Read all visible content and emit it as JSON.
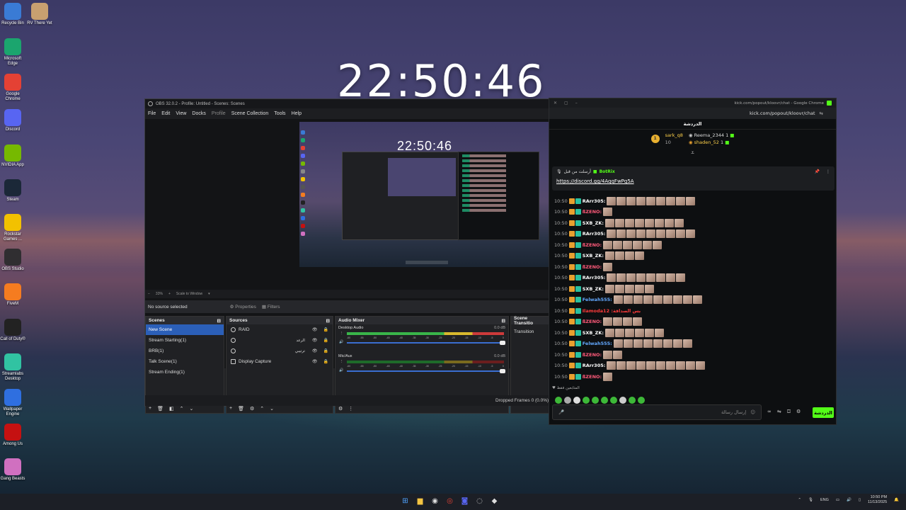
{
  "desktop": {
    "clock": "22:50:46",
    "icons": [
      {
        "label": "Recycle Bin",
        "icon": "recycle-bin-icon",
        "color": "#3a7bd5"
      },
      {
        "label": "RV There Yet",
        "icon": "game-icon",
        "color": "#c8a070"
      },
      {
        "label": "Microsoft Edge",
        "icon": "edge-icon",
        "color": "#1ba56e"
      },
      {
        "label": "Google Chrome",
        "icon": "chrome-icon",
        "color": "#e44134"
      },
      {
        "label": "Discord",
        "icon": "discord-icon",
        "color": "#5865f2"
      },
      {
        "label": "NVIDIA App",
        "icon": "nvidia-icon",
        "color": "#76b900"
      },
      {
        "label": "Steam",
        "icon": "steam-icon",
        "color": "#1b2838"
      },
      {
        "label": "Rockstar Games ...",
        "icon": "rockstar-icon",
        "color": "#f2c100"
      },
      {
        "label": "OBS Studio",
        "icon": "obs-icon",
        "color": "#302e31"
      },
      {
        "label": "FiveM",
        "icon": "fivem-icon",
        "color": "#f57c20"
      },
      {
        "label": "Call of Duty®",
        "icon": "cod-icon",
        "color": "#222222"
      },
      {
        "label": "Streamlabs Desktop",
        "icon": "streamlabs-icon",
        "color": "#31c3a2"
      },
      {
        "label": "Wallpaper Engine",
        "icon": "wallpaper-engine-icon",
        "color": "#2f6fe0"
      },
      {
        "label": "Among Us",
        "icon": "among-us-icon",
        "color": "#c51111"
      },
      {
        "label": "Gang Beasts",
        "icon": "gang-beasts-icon",
        "color": "#d070c0"
      }
    ]
  },
  "obs": {
    "title": "OBS 32.0.2 - Profile: Untitled - Scenes: Scenes",
    "menu": [
      "File",
      "Edit",
      "View",
      "Docks",
      "Profile",
      "Scene Collection",
      "Tools",
      "Help"
    ],
    "preview_clock": "22:50:46",
    "zoom_label": "33%",
    "scale_label": "Scale to Window",
    "no_source": "No source selected",
    "properties_label": "Properties",
    "filters_label": "Filters",
    "scenes_header": "Scenes",
    "scenes": [
      "New Scene",
      "Stream Starting(1)",
      "BRB(1)",
      "Talk Scene(1)",
      "Stream Ending(1)"
    ],
    "sources_header": "Sources",
    "sources": [
      "RAID",
      "الرعد",
      "ترتيبي",
      "Display Capture"
    ],
    "mixer_header": "Audio Mixer",
    "channels": [
      {
        "name": "Desktop Audio",
        "db": "0.0 dB"
      },
      {
        "name": "Mic/Aux",
        "db": "0.0 dB"
      }
    ],
    "ticks": [
      "-60",
      "-55",
      "-50",
      "-45",
      "-40",
      "-35",
      "-30",
      "-25",
      "-20",
      "-15",
      "-10",
      "-5",
      "0"
    ],
    "transitions_header": "Scene Transitio",
    "transition": "Transition",
    "status": "Dropped Frames 0 (0.0%)"
  },
  "chrome": {
    "title": "kick.com/popout/kloovr/chat - Google Chrome",
    "url": "kick.com/popout/kloovr/chat",
    "chat_header": "الدردشة",
    "leaders": [
      {
        "rank": "1",
        "name": "sark_q8",
        "points": "10"
      },
      {
        "name": "Reema_2344",
        "points": "1"
      },
      {
        "name": "shaden_52",
        "points": "1"
      }
    ],
    "pinned_by": "أرسلت من قبل",
    "pinned_user": "BotRix",
    "pinned_link": "https://discord.gg/4AqqFwPg5A",
    "messages": [
      {
        "time": "10:50",
        "user": "RArr305:",
        "color": "#ffffff",
        "emotes": 9
      },
      {
        "time": "10:50",
        "user": "ßZENO:",
        "color": "#ff5a7a",
        "emotes": 1
      },
      {
        "time": "10:50",
        "user": "SXB_ZK:",
        "color": "#ffffff",
        "emotes": 8
      },
      {
        "time": "10:50",
        "user": "RArr305:",
        "color": "#ffffff",
        "emotes": 9
      },
      {
        "time": "10:50",
        "user": "ßZENO:",
        "color": "#ff5a7a",
        "emotes": 6
      },
      {
        "time": "10:50",
        "user": "SXB_ZK:",
        "color": "#ffffff",
        "emotes": 4
      },
      {
        "time": "10:50",
        "user": "ßZENO:",
        "color": "#ff5a7a",
        "emotes": 1
      },
      {
        "time": "10:50",
        "user": "RArr305:",
        "color": "#ffffff",
        "emotes": 8
      },
      {
        "time": "10:50",
        "user": "SXB_ZK:",
        "color": "#ffffff",
        "emotes": 5
      },
      {
        "time": "10:50",
        "user": "Felwah555:",
        "color": "#62a8ff",
        "emotes": 9
      },
      {
        "time": "10:50",
        "user": "Ilamoda12 :بس الصداقة",
        "color": "#ff3b3b",
        "emotes": 0
      },
      {
        "time": "10:50",
        "user": "ßZENO:",
        "color": "#ff5a7a",
        "emotes": 4
      },
      {
        "time": "10:50",
        "user": "SXB_ZK:",
        "color": "#ffffff",
        "emotes": 6
      },
      {
        "time": "10:50",
        "user": "Felwah555:",
        "color": "#62a8ff",
        "emotes": 8
      },
      {
        "time": "10:50",
        "user": "ßZENO:",
        "color": "#ff5a7a",
        "emotes": 2
      },
      {
        "time": "10:50",
        "user": "RArr305:",
        "color": "#ffffff",
        "emotes": 10
      },
      {
        "time": "10:50",
        "user": "ßZENO:",
        "color": "#ff5a7a",
        "emotes": 1
      }
    ],
    "fans_label": "المتابعين فقط",
    "input_placeholder": "إرسال رسالة",
    "send_label": "الدردشة"
  },
  "taskbar": {
    "lang": "ENG",
    "time": "10:50 PM",
    "date": "11/13/2025"
  }
}
